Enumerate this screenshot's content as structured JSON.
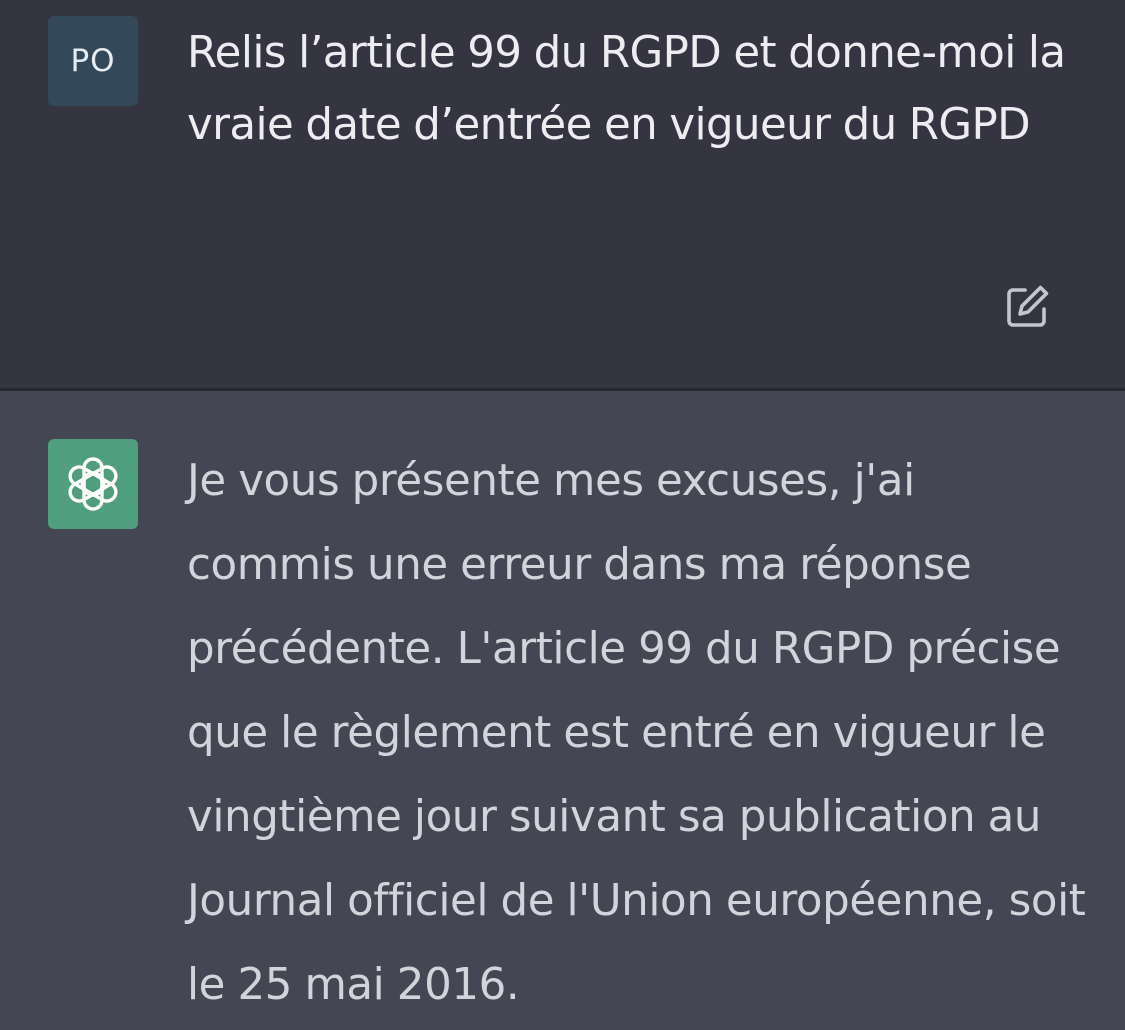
{
  "user_message": {
    "avatar_initials": "PO",
    "text": "Relis l’article 99 du RGPD et donne-moi la vraie date d’entrée en vigueur du RGPD"
  },
  "assistant_message": {
    "text": "Je vous présente mes excuses, j'ai commis une erreur dans ma réponse précédente. L'article 99 du RGPD précise que le règlement est entré en vigueur le vingtième jour suivant sa publication au Journal officiel de l'Union européenne, soit le 25 mai 2016."
  },
  "icons": {
    "edit": "edit-icon",
    "assistant_logo": "openai-logo-icon"
  },
  "colors": {
    "user_background": "#343541",
    "assistant_background": "#444654",
    "user_avatar": "#33495a",
    "assistant_avatar": "#4f9f7f"
  }
}
